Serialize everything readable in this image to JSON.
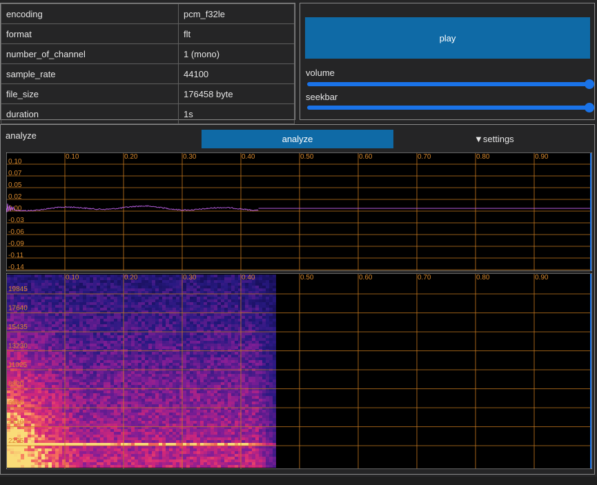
{
  "info": {
    "rows": [
      {
        "key": "encoding",
        "value": "pcm_f32le"
      },
      {
        "key": "format",
        "value": "flt"
      },
      {
        "key": "number_of_channel",
        "value": "1 (mono)"
      },
      {
        "key": "sample_rate",
        "value": "44100"
      },
      {
        "key": "file_size",
        "value": "176458 byte"
      },
      {
        "key": "duration",
        "value": "1s"
      }
    ]
  },
  "player": {
    "play_label": "play",
    "volume_label": "volume",
    "volume_level": 1.0,
    "seekbar_label": "seekbar",
    "seekbar_level": 1.0
  },
  "analyze": {
    "title": "analyze",
    "button_label": "analyze",
    "settings_label": "▼settings",
    "waveform": {
      "x_ticks": [
        "0.10",
        "0.20",
        "0.30",
        "0.40",
        "0.50",
        "0.60",
        "0.70",
        "0.80",
        "0.90"
      ],
      "y_ticks": [
        "0.10",
        "0.07",
        "0.05",
        "0.02",
        "0.00",
        "-0.03",
        "-0.06",
        "-0.09",
        "-0.11",
        "-0.14"
      ],
      "line_color": "#b35cdb",
      "grid_color": "#c77a1f",
      "signal_end": 0.43
    },
    "spectrogram": {
      "x_ticks": [
        "0.10",
        "0.20",
        "0.30",
        "0.40",
        "0.50",
        "0.60",
        "0.70",
        "0.80",
        "0.90"
      ],
      "y_ticks": [
        "19845",
        "17640",
        "15435",
        "13230",
        "11025",
        "8820",
        "6615",
        "4410",
        "2205"
      ],
      "signal_end": 0.46
    }
  }
}
